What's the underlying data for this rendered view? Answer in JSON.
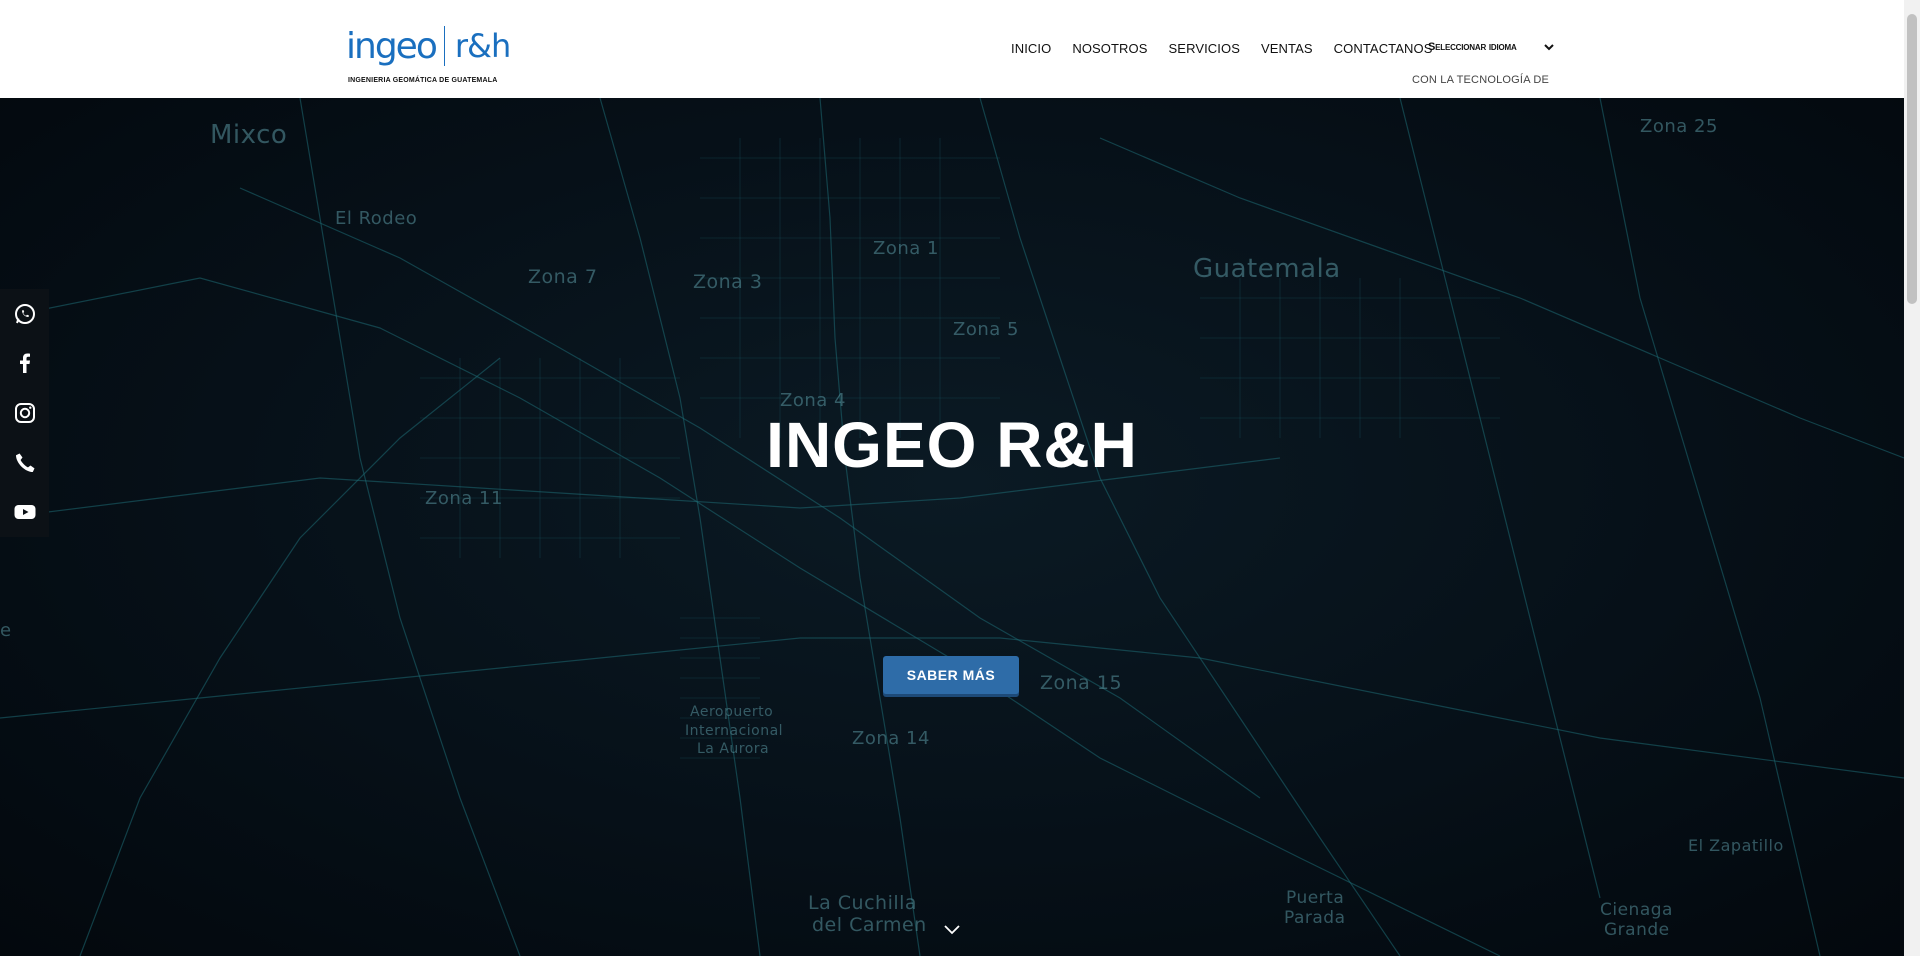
{
  "header": {
    "logo": {
      "brand_left": "ingeo",
      "brand_right": "r&h",
      "tagline": "INGENIERIA GEOMÁTICA DE GUATEMALA"
    },
    "nav": [
      "INICIO",
      "NOSOTROS",
      "SERVICIOS",
      "VENTAS",
      "CONTACTANOS"
    ],
    "language_select": {
      "value": "Seleccionar idioma",
      "icon": "chevron-down-icon"
    },
    "tech_label": "CON LA TECNOLOGÍA DE"
  },
  "hero": {
    "title": "INGEO R&H",
    "cta_label": "SABER MÁS",
    "scroll_icon": "chevron-down-icon",
    "map_labels": [
      "Mixco",
      "El Rodeo",
      "Zona 7",
      "Zona 3",
      "Zona 1",
      "Zona 5",
      "Guatemala",
      "Zona 25",
      "Zona 4",
      "Zona 11",
      "Zona 15",
      "Aeropuerto",
      "Internacional",
      "La Aurora",
      "Zona 14",
      "El Zapatillo",
      "La Cuchilla",
      "del Carmen",
      "Puerta",
      "Parada",
      "Cienaga",
      "Grande",
      "e"
    ]
  },
  "social": [
    {
      "name": "whatsapp",
      "icon": "whatsapp-icon"
    },
    {
      "name": "facebook",
      "icon": "facebook-icon"
    },
    {
      "name": "instagram",
      "icon": "instagram-icon"
    },
    {
      "name": "phone",
      "icon": "phone-icon"
    },
    {
      "name": "youtube",
      "icon": "youtube-icon"
    }
  ],
  "colors": {
    "brand_blue": "#1a6fbf",
    "cta_blue": "#2e6ca8",
    "map_line": "#1f6f78",
    "hero_bg": "#061018"
  }
}
